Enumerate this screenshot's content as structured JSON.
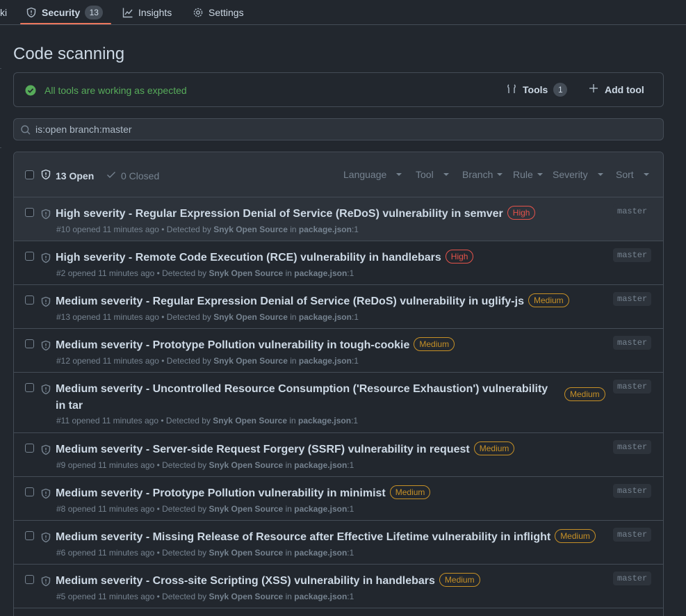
{
  "nav": {
    "partial_label": "ki",
    "security_label": "Security",
    "security_count": "13",
    "insights_label": "Insights",
    "settings_label": "Settings"
  },
  "page": {
    "title": "Code scanning"
  },
  "status": {
    "message": "All tools are working as expected",
    "tools_label": "Tools",
    "tools_count": "1",
    "add_tool_label": "Add tool"
  },
  "search": {
    "value": "is:open branch:master"
  },
  "list_header": {
    "open_label": "13 Open",
    "closed_label": "0 Closed",
    "filters": [
      "Language",
      "Tool",
      "Branch",
      "Rule",
      "Severity",
      "Sort"
    ]
  },
  "alerts": [
    {
      "title": "High severity - Regular Expression Denial of Service (ReDoS) vulnerability in semver",
      "severity": "High",
      "number": "#10",
      "opened": "opened 11 minutes ago",
      "detected": "Detected by",
      "tool": "Snyk Open Source",
      "in": "in",
      "file": "package.json",
      "line": ":1",
      "branch": "master"
    },
    {
      "title": "High severity - Remote Code Execution (RCE) vulnerability in handlebars",
      "severity": "High",
      "number": "#2",
      "opened": "opened 11 minutes ago",
      "detected": "Detected by",
      "tool": "Snyk Open Source",
      "in": "in",
      "file": "package.json",
      "line": ":1",
      "branch": "master"
    },
    {
      "title": "Medium severity - Regular Expression Denial of Service (ReDoS) vulnerability in uglify-js",
      "severity": "Medium",
      "number": "#13",
      "opened": "opened 11 minutes ago",
      "detected": "Detected by",
      "tool": "Snyk Open Source",
      "in": "in",
      "file": "package.json",
      "line": ":1",
      "branch": "master"
    },
    {
      "title": "Medium severity - Prototype Pollution vulnerability in tough-cookie",
      "severity": "Medium",
      "number": "#12",
      "opened": "opened 11 minutes ago",
      "detected": "Detected by",
      "tool": "Snyk Open Source",
      "in": "in",
      "file": "package.json",
      "line": ":1",
      "branch": "master"
    },
    {
      "title": "Medium severity - Uncontrolled Resource Consumption ('Resource Exhaustion') vulnerability in tar",
      "severity": "Medium",
      "number": "#11",
      "opened": "opened 11 minutes ago",
      "detected": "Detected by",
      "tool": "Snyk Open Source",
      "in": "in",
      "file": "package.json",
      "line": ":1",
      "branch": "master"
    },
    {
      "title": "Medium severity - Server-side Request Forgery (SSRF) vulnerability in request",
      "severity": "Medium",
      "number": "#9",
      "opened": "opened 11 minutes ago",
      "detected": "Detected by",
      "tool": "Snyk Open Source",
      "in": "in",
      "file": "package.json",
      "line": ":1",
      "branch": "master"
    },
    {
      "title": "Medium severity - Prototype Pollution vulnerability in minimist",
      "severity": "Medium",
      "number": "#8",
      "opened": "opened 11 minutes ago",
      "detected": "Detected by",
      "tool": "Snyk Open Source",
      "in": "in",
      "file": "package.json",
      "line": ":1",
      "branch": "master"
    },
    {
      "title": "Medium severity - Missing Release of Resource after Effective Lifetime vulnerability in inflight",
      "severity": "Medium",
      "number": "#6",
      "opened": "opened 11 minutes ago",
      "detected": "Detected by",
      "tool": "Snyk Open Source",
      "in": "in",
      "file": "package.json",
      "line": ":1",
      "branch": "master"
    },
    {
      "title": "Medium severity - Cross-site Scripting (XSS) vulnerability in handlebars",
      "severity": "Medium",
      "number": "#5",
      "opened": "opened 11 minutes ago",
      "detected": "Detected by",
      "tool": "Snyk Open Source",
      "in": "in",
      "file": "package.json",
      "line": ":1",
      "branch": "master"
    }
  ],
  "colors": {
    "accent_underline": "#ec775c",
    "success": "#57ab5a",
    "high": "#e5534b",
    "medium": "#c69026"
  }
}
